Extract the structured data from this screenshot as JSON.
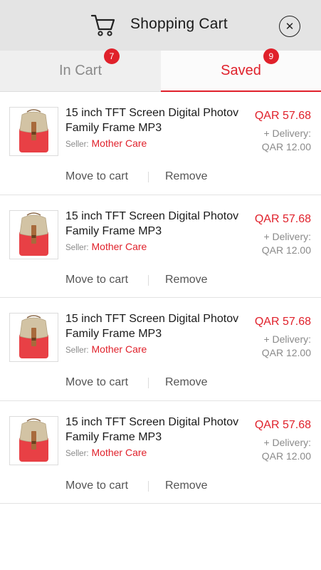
{
  "header": {
    "title": "Shopping Cart",
    "cart_icon": "cart-icon",
    "close_icon": "close-icon",
    "close_glyph": "✕"
  },
  "tabs": [
    {
      "label": "In Cart",
      "badge": "7",
      "active": false
    },
    {
      "label": "Saved",
      "badge": "9",
      "active": true
    }
  ],
  "colors": {
    "accent": "#e0212b",
    "header_bg": "#e4e4e4",
    "muted": "#8a8a8a"
  },
  "items": [
    {
      "title": "15 inch TFT Screen Digital Photov Family Frame MP3",
      "seller_label": "Seller:",
      "seller": "Mother Care",
      "price": "QAR 57.68",
      "delivery_label": "+ Delivery:",
      "delivery_value": "QAR 12.00",
      "move_label": "Move to cart",
      "remove_label": "Remove"
    },
    {
      "title": "15 inch TFT Screen Digital Photov Family Frame MP3",
      "seller_label": "Seller:",
      "seller": "Mother Care",
      "price": "QAR 57.68",
      "delivery_label": "+ Delivery:",
      "delivery_value": "QAR 12.00",
      "move_label": "Move to cart",
      "remove_label": "Remove"
    },
    {
      "title": "15 inch TFT Screen Digital Photov Family Frame MP3",
      "seller_label": "Seller:",
      "seller": "Mother Care",
      "price": "QAR 57.68",
      "delivery_label": "+ Delivery:",
      "delivery_value": "QAR 12.00",
      "move_label": "Move to cart",
      "remove_label": "Remove"
    },
    {
      "title": "15 inch TFT Screen Digital Photov Family Frame MP3",
      "seller_label": "Seller:",
      "seller": "Mother Care",
      "price": "QAR 57.68",
      "delivery_label": "+ Delivery:",
      "delivery_value": "QAR 12.00",
      "move_label": "Move to cart",
      "remove_label": "Remove"
    }
  ]
}
